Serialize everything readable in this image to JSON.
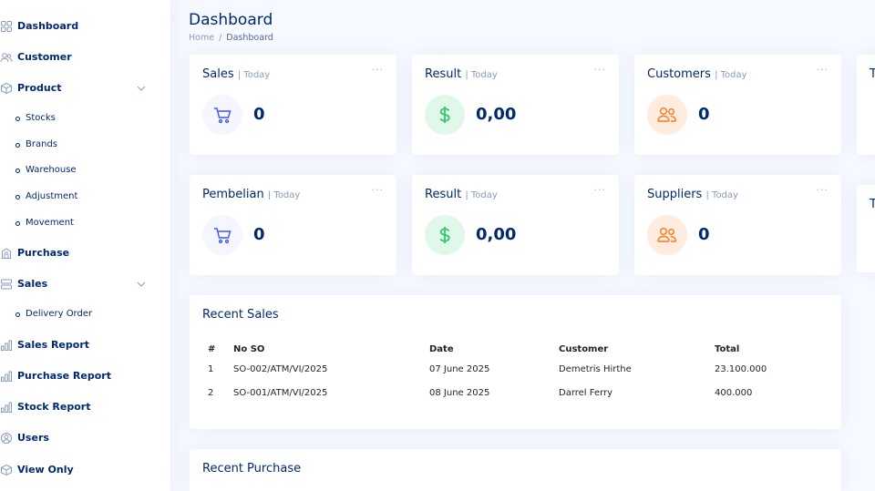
{
  "sidebar": {
    "dashboard": "Dashboard",
    "customer": "Customer",
    "product": "Product",
    "stocks": "Stocks",
    "brands": "Brands",
    "warehouse": "Warehouse",
    "adjustment": "Adjustment",
    "movement": "Movement",
    "purchase": "Purchase",
    "sales": "Sales",
    "delivery_order": "Delivery Order",
    "sales_report": "Sales Report",
    "purchase_report": "Purchase Report",
    "stock_report": "Stock Report",
    "users": "Users",
    "view_only": "View Only"
  },
  "header": {
    "title": "Dashboard",
    "breadcrumb_home": "Home",
    "breadcrumb_sep": "/",
    "breadcrumb_current": "Dashboard"
  },
  "cards": {
    "sales": {
      "title": "Sales",
      "period": "| Today",
      "value": "0",
      "menu": "···"
    },
    "result1": {
      "title": "Result",
      "period": "| Today",
      "value": "0,00",
      "menu": "···"
    },
    "customers": {
      "title": "Customers",
      "period": "| Today",
      "value": "0",
      "menu": "···"
    },
    "pembelian": {
      "title": "Pembelian",
      "period": "| Today",
      "value": "0",
      "menu": "···"
    },
    "result2": {
      "title": "Result",
      "period": "| Today",
      "value": "0,00",
      "menu": "···"
    },
    "suppliers": {
      "title": "Suppliers",
      "period": "| Today",
      "value": "0",
      "menu": "···"
    },
    "partial1": {
      "title": "T"
    },
    "partial2": {
      "title": "T"
    }
  },
  "recent_sales": {
    "title": "Recent Sales",
    "columns": [
      "#",
      "No SO",
      "Date",
      "Customer",
      "Total"
    ],
    "rows": [
      [
        "1",
        "SO-002/ATM/VI/2025",
        "07 June 2025",
        "Demetris Hirthe",
        "23.100.000"
      ],
      [
        "2",
        "SO-001/ATM/VI/2025",
        "08 June 2025",
        "Darrel Ferry",
        "400.000"
      ]
    ]
  },
  "recent_purchase": {
    "title": "Recent Purchase"
  },
  "colors": {
    "primary": "#012970",
    "muted": "#899bbd",
    "blue_icon": "#4154f1",
    "green_icon": "#2eca6a",
    "orange_icon": "#ff771d"
  },
  "icons": {
    "card_sales": "cart-icon",
    "card_result": "dollar-icon",
    "card_people": "people-icon"
  }
}
